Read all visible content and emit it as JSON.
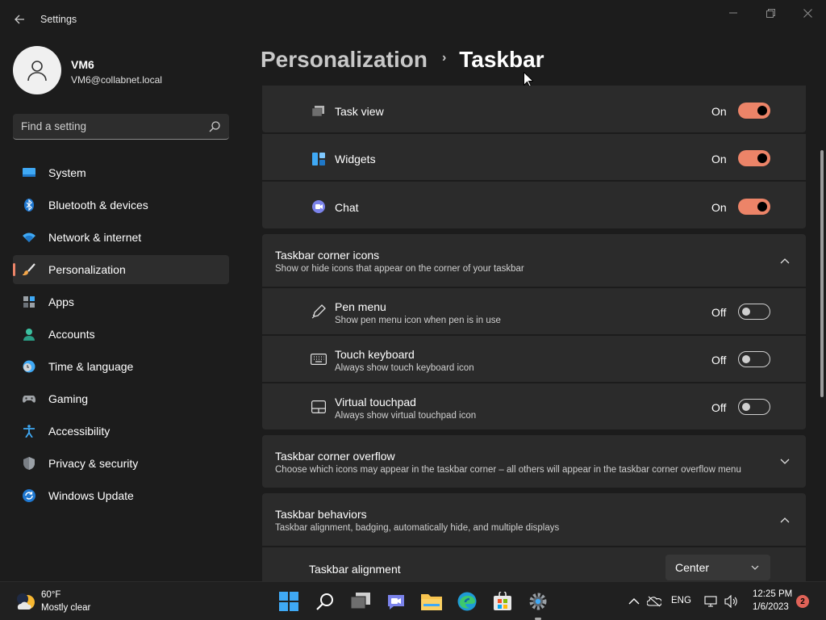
{
  "app": {
    "title": "Settings",
    "accent_color": "#ec8468"
  },
  "user": {
    "name": "VM6",
    "email": "VM6@collabnet.local"
  },
  "search": {
    "placeholder": "Find a setting"
  },
  "sidebar": {
    "items": [
      {
        "label": "System",
        "icon": "monitor-icon"
      },
      {
        "label": "Bluetooth & devices",
        "icon": "bluetooth-icon"
      },
      {
        "label": "Network & internet",
        "icon": "wifi-icon"
      },
      {
        "label": "Personalization",
        "icon": "brush-icon",
        "active": true
      },
      {
        "label": "Apps",
        "icon": "apps-icon"
      },
      {
        "label": "Accounts",
        "icon": "person-icon"
      },
      {
        "label": "Time & language",
        "icon": "clock-globe-icon"
      },
      {
        "label": "Gaming",
        "icon": "gamepad-icon"
      },
      {
        "label": "Accessibility",
        "icon": "accessibility-icon"
      },
      {
        "label": "Privacy & security",
        "icon": "shield-icon"
      },
      {
        "label": "Windows Update",
        "icon": "update-icon"
      }
    ]
  },
  "breadcrumb": {
    "parent": "Personalization",
    "separator": "›",
    "current": "Taskbar"
  },
  "taskbar_items": [
    {
      "label": "Task view",
      "state": "On",
      "on": true,
      "icon": "task-view-icon"
    },
    {
      "label": "Widgets",
      "state": "On",
      "on": true,
      "icon": "widgets-icon"
    },
    {
      "label": "Chat",
      "state": "On",
      "on": true,
      "icon": "chat-icon"
    }
  ],
  "corner_icons": {
    "title": "Taskbar corner icons",
    "subtitle": "Show or hide icons that appear on the corner of your taskbar",
    "expanded": true,
    "items": [
      {
        "label": "Pen menu",
        "sub": "Show pen menu icon when pen is in use",
        "state": "Off",
        "on": false,
        "icon": "pen-icon"
      },
      {
        "label": "Touch keyboard",
        "sub": "Always show touch keyboard icon",
        "state": "Off",
        "on": false,
        "icon": "keyboard-icon"
      },
      {
        "label": "Virtual touchpad",
        "sub": "Always show virtual touchpad icon",
        "state": "Off",
        "on": false,
        "icon": "touchpad-icon"
      }
    ]
  },
  "corner_overflow": {
    "title": "Taskbar corner overflow",
    "subtitle": "Choose which icons may appear in the taskbar corner – all others will appear in the taskbar corner overflow menu",
    "expanded": false
  },
  "behaviors": {
    "title": "Taskbar behaviors",
    "subtitle": "Taskbar alignment, badging, automatically hide, and multiple displays",
    "expanded": true,
    "alignment_label": "Taskbar alignment",
    "alignment_value": "Center"
  },
  "weather": {
    "temp": "60°F",
    "desc": "Mostly clear"
  },
  "tray": {
    "lang": "ENG",
    "time": "12:25 PM",
    "date": "1/6/2023",
    "notifications": "2"
  }
}
